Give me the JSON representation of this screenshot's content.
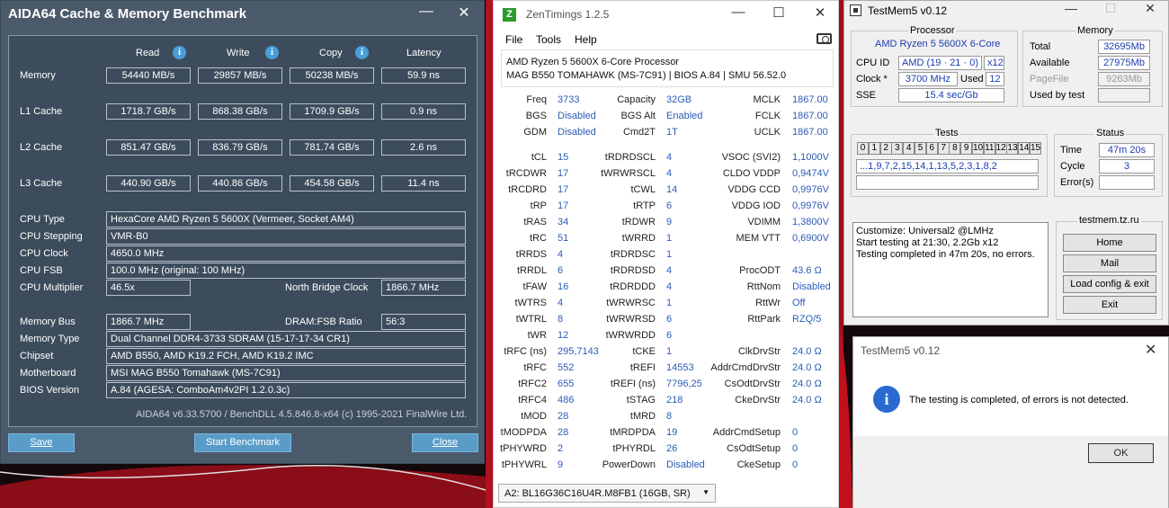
{
  "aida": {
    "title": "AIDA64 Cache & Memory Benchmark",
    "minimize": "—",
    "close": "✕",
    "headers": {
      "read": "Read",
      "write": "Write",
      "copy": "Copy",
      "latency": "Latency"
    },
    "rows": [
      {
        "label": "Memory",
        "read": "54440 MB/s",
        "write": "29857 MB/s",
        "copy": "50238 MB/s",
        "latency": "59.9 ns"
      },
      {
        "label": "L1 Cache",
        "read": "1718.7 GB/s",
        "write": "868.38 GB/s",
        "copy": "1709.9 GB/s",
        "latency": "0.9 ns"
      },
      {
        "label": "L2 Cache",
        "read": "851.47 GB/s",
        "write": "836.79 GB/s",
        "copy": "781.74 GB/s",
        "latency": "2.6 ns"
      },
      {
        "label": "L3 Cache",
        "read": "440.90 GB/s",
        "write": "440.86 GB/s",
        "copy": "454.58 GB/s",
        "latency": "11.4 ns"
      }
    ],
    "info": [
      {
        "label": "CPU Type",
        "value": "HexaCore AMD Ryzen 5 5600X  (Vermeer, Socket AM4)"
      },
      {
        "label": "CPU Stepping",
        "value": "VMR-B0"
      },
      {
        "label": "CPU Clock",
        "value": "4650.0 MHz"
      },
      {
        "label": "CPU FSB",
        "value": "100.0 MHz  (original: 100 MHz)"
      },
      {
        "label": "CPU Multiplier",
        "value": "46.5x"
      }
    ],
    "nb_label": "North Bridge Clock",
    "nb_value": "1866.7 MHz",
    "mem_bus_label": "Memory Bus",
    "mem_bus_value": "1866.7 MHz",
    "dram_label": "DRAM:FSB Ratio",
    "dram_value": "56:3",
    "info2": [
      {
        "label": "Memory Type",
        "value": "Dual Channel DDR4-3733 SDRAM  (15-17-17-34 CR1)"
      },
      {
        "label": "Chipset",
        "value": "AMD B550, AMD K19.2 FCH, AMD K19.2 IMC"
      },
      {
        "label": "Motherboard",
        "value": "MSI MAG B550 Tomahawk (MS-7C91)"
      },
      {
        "label": "BIOS Version",
        "value": "A.84  (AGESA: ComboAm4v2PI 1.2.0.3c)"
      }
    ],
    "footer": "AIDA64 v6.33.5700 / BenchDLL 4.5.846.8-x64  (c) 1995-2021 FinalWire Ltd.",
    "save": "Save",
    "start": "Start Benchmark",
    "close_btn": "Close"
  },
  "zen": {
    "title": "ZenTimings 1.2.5",
    "logo": "Z",
    "menu": [
      "File",
      "Tools",
      "Help"
    ],
    "cpu": "AMD Ryzen 5 5600X 6-Core Processor",
    "board": "MAG B550 TOMAHAWK (MS-7C91) | BIOS A.84 | SMU 56.52.0",
    "col1": [
      [
        "Freq",
        "3733"
      ],
      [
        "BGS",
        "Disabled"
      ],
      [
        "GDM",
        "Disabled"
      ],
      [
        "",
        ""
      ],
      [
        "tCL",
        "15"
      ],
      [
        "tRCDWR",
        "17"
      ],
      [
        "tRCDRD",
        "17"
      ],
      [
        "tRP",
        "17"
      ],
      [
        "tRAS",
        "34"
      ],
      [
        "tRC",
        "51"
      ],
      [
        "tRRDS",
        "4"
      ],
      [
        "tRRDL",
        "6"
      ],
      [
        "tFAW",
        "16"
      ],
      [
        "tWTRS",
        "4"
      ],
      [
        "tWTRL",
        "8"
      ],
      [
        "tWR",
        "12"
      ],
      [
        "tRFC (ns)",
        "295,7143"
      ],
      [
        "tRFC",
        "552"
      ],
      [
        "tRFC2",
        "655"
      ],
      [
        "tRFC4",
        "486"
      ],
      [
        "tMOD",
        "28"
      ],
      [
        "tMODPDA",
        "28"
      ],
      [
        "tPHYWRD",
        "2"
      ],
      [
        "tPHYWRL",
        "9"
      ]
    ],
    "col2": [
      [
        "Capacity",
        "32GB"
      ],
      [
        "BGS Alt",
        "Enabled"
      ],
      [
        "Cmd2T",
        "1T"
      ],
      [
        "",
        ""
      ],
      [
        "tRDRDSCL",
        "4"
      ],
      [
        "tWRWRSCL",
        "4"
      ],
      [
        "tCWL",
        "14"
      ],
      [
        "tRTP",
        "6"
      ],
      [
        "tRDWR",
        "9"
      ],
      [
        "tWRRD",
        "1"
      ],
      [
        "tRDRDSC",
        "1"
      ],
      [
        "tRDRDSD",
        "4"
      ],
      [
        "tRDRDDD",
        "4"
      ],
      [
        "tWRWRSC",
        "1"
      ],
      [
        "tWRWRSD",
        "6"
      ],
      [
        "tWRWRDD",
        "6"
      ],
      [
        "tCKE",
        "1"
      ],
      [
        "tREFI",
        "14553"
      ],
      [
        "tREFI (ns)",
        "7796,25"
      ],
      [
        "tSTAG",
        "218"
      ],
      [
        "tMRD",
        "8"
      ],
      [
        "tMRDPDA",
        "19"
      ],
      [
        "tPHYRDL",
        "26"
      ],
      [
        "PowerDown",
        "Disabled"
      ]
    ],
    "col3": [
      [
        "MCLK",
        "1867.00"
      ],
      [
        "FCLK",
        "1867.00"
      ],
      [
        "UCLK",
        "1867.00"
      ],
      [
        "",
        ""
      ],
      [
        "VSOC (SVI2)",
        "1,1000V"
      ],
      [
        "CLDO VDDP",
        "0,9474V"
      ],
      [
        "VDDG CCD",
        "0,9976V"
      ],
      [
        "VDDG IOD",
        "0,9976V"
      ],
      [
        "VDIMM",
        "1,3800V"
      ],
      [
        "MEM VTT",
        "0,6900V"
      ],
      [
        "",
        ""
      ],
      [
        "ProcODT",
        "43.6 Ω"
      ],
      [
        "RttNom",
        "Disabled"
      ],
      [
        "RttWr",
        "Off"
      ],
      [
        "RttPark",
        "RZQ/5"
      ],
      [
        "",
        ""
      ],
      [
        "ClkDrvStr",
        "24.0 Ω"
      ],
      [
        "AddrCmdDrvStr",
        "24.0 Ω"
      ],
      [
        "CsOdtDrvStr",
        "24.0 Ω"
      ],
      [
        "CkeDrvStr",
        "24.0 Ω"
      ],
      [
        "",
        ""
      ],
      [
        "AddrCmdSetup",
        "0"
      ],
      [
        "CsOdtSetup",
        "0"
      ],
      [
        "CkeSetup",
        "0"
      ]
    ],
    "dimm": "A2: BL16G36C16U4R.M8FB1 (16GB, SR)"
  },
  "tm": {
    "title": "TestMem5 v0.12",
    "processor_h": "Processor",
    "cpu_name": "AMD Ryzen 5 5600X 6-Core",
    "cpuid_l": "CPU ID",
    "cpuid_v": "AMD  (19 · 21 · 0)",
    "cpuid_x": "x12",
    "clock_l": "Clock *",
    "clock_v": "3700 MHz",
    "used_l": "Used",
    "used_v": "12",
    "sse_l": "SSE",
    "sse_v": "15.4 sec/Gb",
    "memory_h": "Memory",
    "total_l": "Total",
    "total_v": "32695Mb",
    "avail_l": "Available",
    "avail_v": "27975Mb",
    "page_l": "PageFile",
    "page_v": "9263Mb",
    "usedby_l": "Used by test",
    "tests_h": "Tests",
    "cells": [
      "0",
      "1",
      "2",
      "3",
      "4",
      "5",
      "6",
      "7",
      "8",
      "9",
      "10",
      "11",
      "12",
      "13",
      "14",
      "15"
    ],
    "seq": "...1,9,7,2,15,14,1,13,5,2,3,1,8,2",
    "status_h": "Status",
    "time_l": "Time",
    "time_v": "47m 20s",
    "cycle_l": "Cycle",
    "cycle_v": "3",
    "err_l": "Error(s)",
    "log": [
      "Customize: Universal2 @LMHz",
      "Start testing at 21:30, 2.2Gb x12",
      "Testing completed in 47m 20s, no errors."
    ],
    "site_h": "testmem.tz.ru",
    "btns": [
      "Home",
      "Mail",
      "Load config & exit",
      "Exit"
    ]
  },
  "dlg": {
    "title": "TestMem5 v0.12",
    "close": "✕",
    "icon": "i",
    "msg": "The testing is completed, of errors is not detected.",
    "ok": "OK"
  }
}
